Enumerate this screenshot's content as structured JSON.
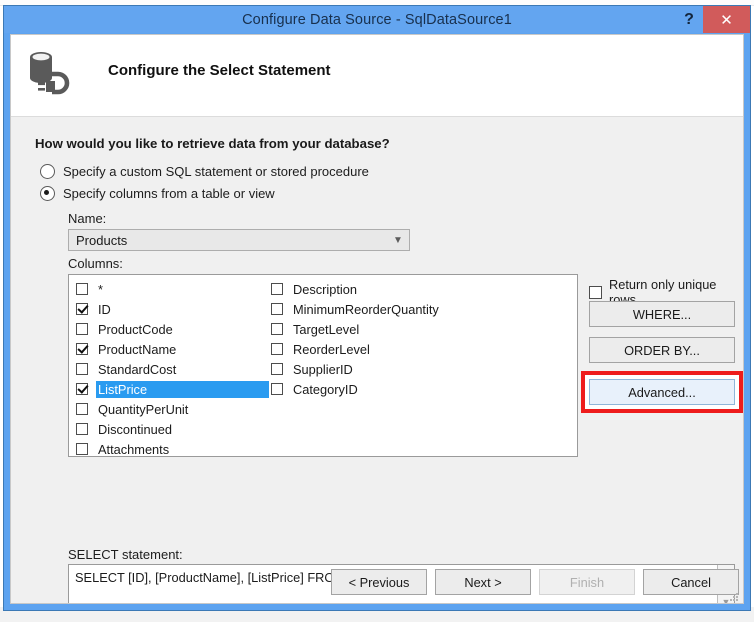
{
  "window": {
    "title": "Configure Data Source - SqlDataSource1",
    "help_label": "?",
    "close_label": "✕"
  },
  "banner": {
    "icon": "database-connection-icon",
    "heading": "Configure the Select Statement"
  },
  "content": {
    "question": "How would you like to retrieve data from your database?",
    "radios": [
      {
        "label": "Specify a custom SQL statement or stored procedure",
        "checked": false
      },
      {
        "label": "Specify columns from a table or view",
        "checked": true
      }
    ],
    "name_label": "Name:",
    "name_value": "Products",
    "columns_label": "Columns:",
    "columns_left": [
      {
        "label": "*",
        "checked": false,
        "selected": false
      },
      {
        "label": "ID",
        "checked": true,
        "selected": false
      },
      {
        "label": "ProductCode",
        "checked": false,
        "selected": false
      },
      {
        "label": "ProductName",
        "checked": true,
        "selected": false
      },
      {
        "label": "StandardCost",
        "checked": false,
        "selected": false
      },
      {
        "label": "ListPrice",
        "checked": true,
        "selected": true
      },
      {
        "label": "QuantityPerUnit",
        "checked": false,
        "selected": false
      },
      {
        "label": "Discontinued",
        "checked": false,
        "selected": false
      },
      {
        "label": "Attachments",
        "checked": false,
        "selected": false
      }
    ],
    "columns_right": [
      {
        "label": "Description",
        "checked": false,
        "selected": false
      },
      {
        "label": "MinimumReorderQuantity",
        "checked": false,
        "selected": false
      },
      {
        "label": "TargetLevel",
        "checked": false,
        "selected": false
      },
      {
        "label": "ReorderLevel",
        "checked": false,
        "selected": false
      },
      {
        "label": "SupplierID",
        "checked": false,
        "selected": false
      },
      {
        "label": "CategoryID",
        "checked": false,
        "selected": false
      }
    ],
    "unique_rows": {
      "label": "Return only unique rows",
      "checked": false
    },
    "where_label": "WHERE...",
    "orderby_label": "ORDER BY...",
    "advanced_label": "Advanced...",
    "select_label": "SELECT statement:",
    "select_value": "SELECT [ID], [ProductName], [ListPrice] FROM [Products]"
  },
  "footer": {
    "previous_label": "< Previous",
    "next_label": "Next >",
    "finish_label": "Finish",
    "cancel_label": "Cancel"
  },
  "colors": {
    "titlebar": "#63a5f0",
    "close_button": "#d15b5b",
    "selection": "#2a9bf0",
    "highlight_box": "#ee1c1c",
    "dialog_background": "#f0f0f0"
  }
}
